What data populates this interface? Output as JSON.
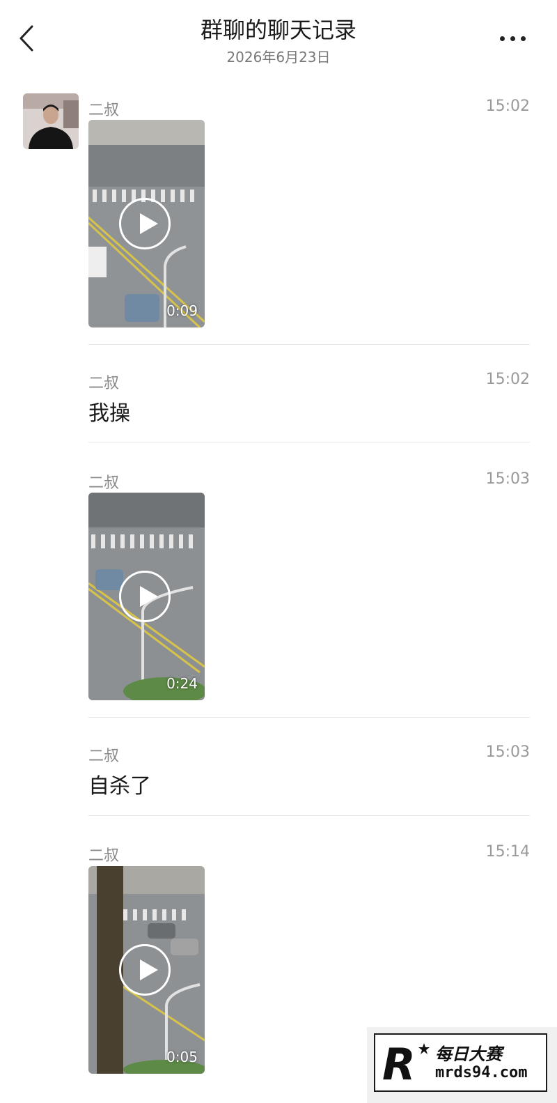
{
  "header": {
    "title": "群聊的聊天记录",
    "subtitle": "2026年6月23日",
    "back_icon": "chevron-left-icon",
    "more_icon": "more-horizontal-icon"
  },
  "avatar_icon": "avatar",
  "messages": [
    {
      "sender": "二叔",
      "time": "15:02",
      "type": "video",
      "duration": "0:09"
    },
    {
      "sender": "二叔",
      "time": "15:02",
      "type": "text",
      "text": "我操"
    },
    {
      "sender": "二叔",
      "time": "15:03",
      "type": "video",
      "duration": "0:24"
    },
    {
      "sender": "二叔",
      "time": "15:03",
      "type": "text",
      "text": "自杀了"
    },
    {
      "sender": "二叔",
      "time": "15:14",
      "type": "video",
      "duration": "0:05"
    }
  ],
  "watermark": {
    "line1": "每日大赛",
    "line2": "mrds94.com",
    "logo_letter": "R",
    "colors": {
      "background": "#f0f0f0",
      "border": "#1a1a1a"
    }
  },
  "colors": {
    "divider": "#e5e5e5",
    "meta_text": "#999999",
    "body_text": "#1a1a1a"
  }
}
